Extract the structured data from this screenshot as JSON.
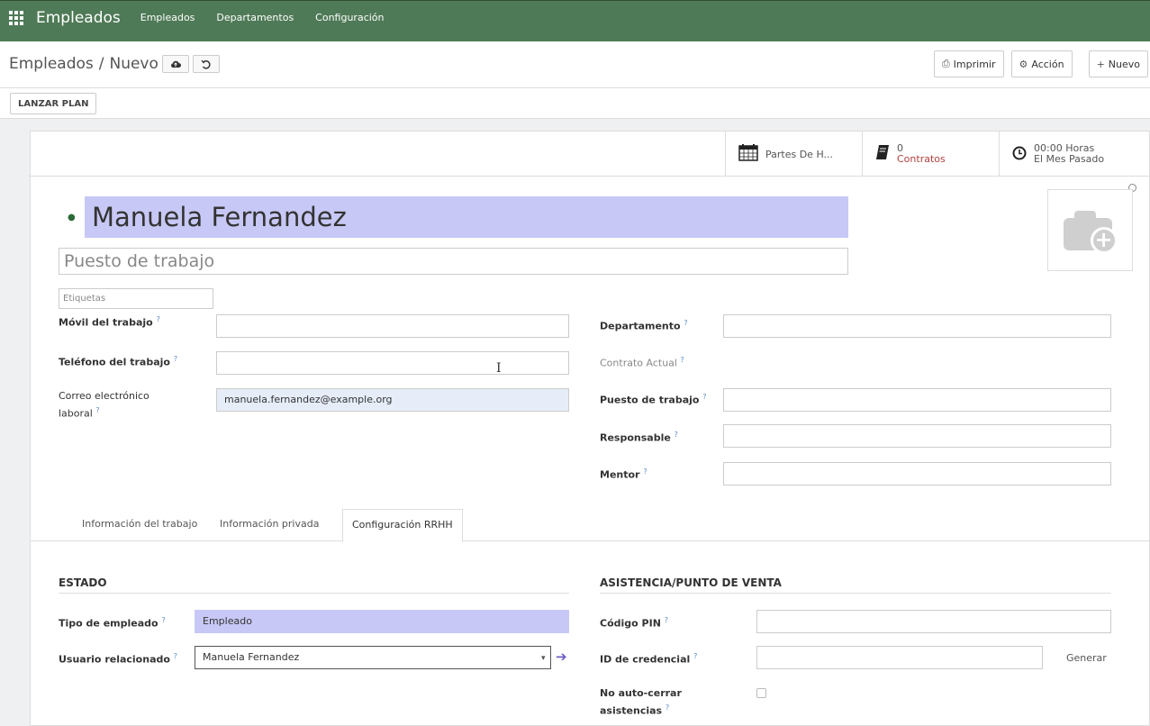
{
  "navbar": {
    "app_name": "Empleados",
    "items": [
      "Empleados",
      "Departamentos",
      "Configuración"
    ]
  },
  "breadcrumb": {
    "parent": "Empleados",
    "separator": "/",
    "current": "Nuevo",
    "save_icon": "cloud-upload-icon",
    "discard_icon": "undo-icon"
  },
  "actions": {
    "print": "Imprimir",
    "action": "Acción",
    "new": "Nuevo"
  },
  "statusbar": {
    "launch_plan": "LANZAR PLAN"
  },
  "smart_buttons": {
    "timesheets": "Partes De H...",
    "contracts_count": "0",
    "contracts_label": "Contratos",
    "hours_value": "00:00 Horas",
    "hours_label": "El Mes Pasado"
  },
  "employee": {
    "name": "Manuela Fernandez",
    "job_title_placeholder": "Puesto de trabajo",
    "tags_placeholder": "Etiquetas"
  },
  "left_fields": {
    "mobile_label": "Móvil del trabajo",
    "mobile_value": "",
    "phone_label": "Teléfono del trabajo",
    "phone_value": "",
    "email_label_1": "Correo electrónico",
    "email_label_2": "laboral",
    "email_value": "manuela.fernandez@example.org"
  },
  "right_fields": {
    "department_label": "Departamento",
    "contract_label": "Contrato Actual",
    "job_position_label": "Puesto de trabajo",
    "manager_label": "Responsable",
    "mentor_label": "Mentor"
  },
  "tabs": [
    "Información del trabajo",
    "Información privada",
    "Configuración RRHH"
  ],
  "estado": {
    "title": "ESTADO",
    "employee_type_label": "Tipo de empleado",
    "employee_type_value": "Empleado",
    "related_user_label": "Usuario relacionado",
    "related_user_value": "Manuela Fernandez"
  },
  "attendance": {
    "title": "ASISTENCIA/PUNTO DE VENTA",
    "pin_label": "Código PIN",
    "badge_label": "ID de credencial",
    "generate": "Generar",
    "no_autoclose_1": "No auto-cerrar",
    "no_autoclose_2": "asistencias"
  },
  "help_mark": "?",
  "colors": {
    "navbar": "#4f7a57",
    "name_highlight": "#c8c8f6",
    "link_red": "#b0413e",
    "help_blue": "#5b8ac7"
  }
}
